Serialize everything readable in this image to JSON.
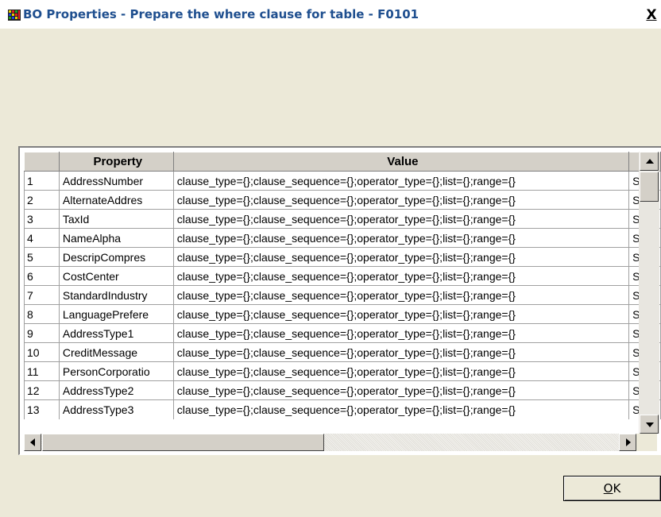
{
  "window": {
    "title": "BO Properties - Prepare the where clause for table - F0101",
    "close_label": "X"
  },
  "grid": {
    "columns": [
      "",
      "Property",
      "Value",
      ""
    ],
    "rows": [
      {
        "num": "1",
        "property": "AddressNumber",
        "value": "clause_type={};clause_sequence={};operator_type={};list={};range={}",
        "extra": "St"
      },
      {
        "num": "2",
        "property": "AlternateAddres",
        "value": "clause_type={};clause_sequence={};operator_type={};list={};range={}",
        "extra": "St"
      },
      {
        "num": "3",
        "property": "TaxId",
        "value": "clause_type={};clause_sequence={};operator_type={};list={};range={}",
        "extra": "St"
      },
      {
        "num": "4",
        "property": "NameAlpha",
        "value": "clause_type={};clause_sequence={};operator_type={};list={};range={}",
        "extra": "St"
      },
      {
        "num": "5",
        "property": "DescripCompres",
        "value": "clause_type={};clause_sequence={};operator_type={};list={};range={}",
        "extra": "St"
      },
      {
        "num": "6",
        "property": "CostCenter",
        "value": "clause_type={};clause_sequence={};operator_type={};list={};range={}",
        "extra": "St"
      },
      {
        "num": "7",
        "property": "StandardIndustry",
        "value": "clause_type={};clause_sequence={};operator_type={};list={};range={}",
        "extra": "St"
      },
      {
        "num": "8",
        "property": "LanguagePrefere",
        "value": "clause_type={};clause_sequence={};operator_type={};list={};range={}",
        "extra": "St"
      },
      {
        "num": "9",
        "property": "AddressType1",
        "value": "clause_type={};clause_sequence={};operator_type={};list={};range={}",
        "extra": "St"
      },
      {
        "num": "10",
        "property": "CreditMessage",
        "value": "clause_type={};clause_sequence={};operator_type={};list={};range={}",
        "extra": "St"
      },
      {
        "num": "11",
        "property": "PersonCorporatio",
        "value": "clause_type={};clause_sequence={};operator_type={};list={};range={}",
        "extra": "St"
      },
      {
        "num": "12",
        "property": "AddressType2",
        "value": "clause_type={};clause_sequence={};operator_type={};list={};range={}",
        "extra": "St"
      },
      {
        "num": "13",
        "property": "AddressType3",
        "value": "clause_type={};clause_sequence={};operator_type={};list={};range={}",
        "extra": "St"
      }
    ]
  },
  "buttons": {
    "ok_prefix": "O",
    "ok_rest": "K"
  },
  "icons": {
    "app": "app-grid-icon",
    "scroll_up": "arrow-up-icon",
    "scroll_down": "arrow-down-icon",
    "scroll_left": "arrow-left-icon",
    "scroll_right": "arrow-right-icon"
  },
  "colors": {
    "title_text": "#1f4f8f",
    "dialog_bg": "#ece9d8",
    "header_bg": "#d4d0c8"
  }
}
